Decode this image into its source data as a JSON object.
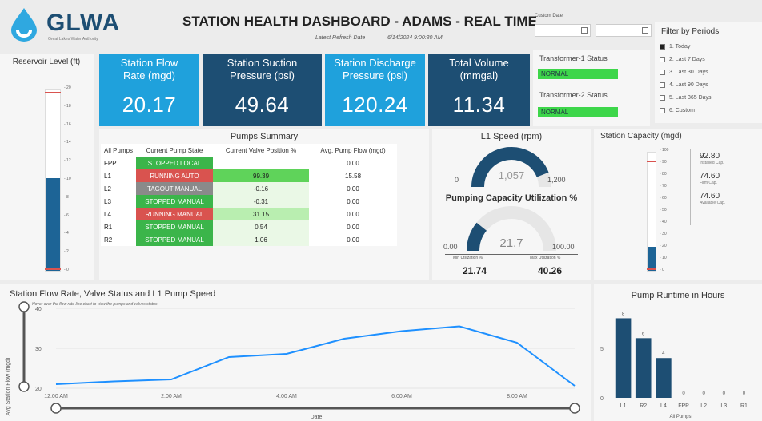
{
  "header": {
    "logo_text": "GLWA",
    "logo_sub": "Great Lakes Water Authority",
    "title": "STATION HEALTH DASHBOARD - ADAMS - REAL TIME",
    "refresh_label": "Latest Refresh Date",
    "refresh_value": "6/14/2024 9:00:30 AM",
    "custom_date_label": "Custom Date"
  },
  "filter": {
    "title": "Filter by Periods",
    "options": [
      "1. Today",
      "2. Last 7 Days",
      "3. Last 30 Days",
      "4. Last 90 Days",
      "5. Last 365 Days",
      "6. Custom"
    ],
    "selected_index": 0
  },
  "kpis": [
    {
      "title": "Station Flow Rate (mgd)",
      "value": "20.17",
      "color": "#1fa1dc"
    },
    {
      "title": "Station Suction Pressure (psi)",
      "value": "49.64",
      "color": "#1d4e73"
    },
    {
      "title": "Station Discharge Pressure (psi)",
      "value": "120.24",
      "color": "#1fa1dc"
    },
    {
      "title": "Total Volume (mmgal)",
      "value": "11.34",
      "color": "#1d4e73"
    }
  ],
  "transformers": [
    {
      "label": "Transformer-1 Status",
      "value": "NORMAL"
    },
    {
      "label": "Transformer-2 Status",
      "value": "NORMAL"
    }
  ],
  "reservoir": {
    "title": "Reservoir Level (ft)",
    "ticks": [
      "20",
      "18",
      "16",
      "14",
      "12",
      "10",
      "8",
      "6",
      "4",
      "2",
      "0"
    ],
    "level": 10.3,
    "max": 20
  },
  "pumps": {
    "title": "Pumps Summary",
    "headers": [
      "All Pumps",
      "Current Pump State",
      "Current Valve Position %",
      "Avg. Pump Flow (mgd)"
    ],
    "rows": [
      {
        "pump": "FPP",
        "state": "STOPPED LOCAL",
        "state_color": "green",
        "valve": "",
        "flow": "0.00"
      },
      {
        "pump": "L1",
        "state": "RUNNING AUTO",
        "state_color": "red",
        "valve": "99.39",
        "flow": "15.58"
      },
      {
        "pump": "L2",
        "state": "TAGOUT MANUAL",
        "state_color": "grey",
        "valve": "-0.16",
        "flow": "0.00"
      },
      {
        "pump": "L3",
        "state": "STOPPED MANUAL",
        "state_color": "green",
        "valve": "-0.31",
        "flow": "0.00"
      },
      {
        "pump": "L4",
        "state": "RUNNING MANUAL",
        "state_color": "red",
        "valve": "31.15",
        "flow": "0.00"
      },
      {
        "pump": "R1",
        "state": "STOPPED MANUAL",
        "state_color": "green",
        "valve": "0.54",
        "flow": "0.00"
      },
      {
        "pump": "R2",
        "state": "STOPPED MANUAL",
        "state_color": "green",
        "valve": "1.06",
        "flow": "0.00"
      }
    ]
  },
  "l1_speed": {
    "title": "L1 Speed (rpm)",
    "value": "1,057",
    "min": "0",
    "max": "1,200",
    "fraction": 0.881
  },
  "utilization": {
    "title": "Pumping Capacity Utilization %",
    "value": "21.7",
    "min": "0.00",
    "max": "100.00",
    "fraction": 0.217,
    "min_label": "Min Utilization %",
    "max_label": "Max Utilization %",
    "min_value": "21.74",
    "max_value": "40.26"
  },
  "capacity": {
    "title": "Station Capacity (mgd)",
    "ticks": [
      "100",
      "90",
      "80",
      "70",
      "60",
      "50",
      "40",
      "30",
      "20",
      "10",
      "0"
    ],
    "level": 20.17,
    "items": [
      {
        "value": "92.80",
        "label": "Installed Cap."
      },
      {
        "value": "74.60",
        "label": "Firm Cap."
      },
      {
        "value": "74.60",
        "label": "Available Cap."
      }
    ]
  },
  "chart_data": [
    {
      "type": "line",
      "title": "Station Flow Rate, Valve Status and L1 Pump Speed",
      "subtitle": "Hover over the flow rate line chart to view the pumps and valves status",
      "xlabel": "Date",
      "ylabel": "Avg Station Flow (mgd)",
      "x_ticks": [
        "12:00 AM",
        "2:00 AM",
        "4:00 AM",
        "6:00 AM",
        "8:00 AM"
      ],
      "y_ticks": [
        "40",
        "30",
        "20"
      ],
      "ylim": [
        20,
        40
      ],
      "x": [
        0.0,
        1.0,
        2.0,
        3.0,
        4.0,
        5.0,
        6.0,
        7.0,
        8.0,
        9.0
      ],
      "values": [
        21.0,
        21.7,
        22.2,
        27.8,
        28.6,
        32.4,
        34.3,
        35.5,
        31.4,
        20.6
      ]
    },
    {
      "type": "bar",
      "title": "Pump Runtime in Hours",
      "xlabel": "All Pumps",
      "y_ticks": [
        "5",
        "0"
      ],
      "categories": [
        "L1",
        "R2",
        "L4",
        "FPP",
        "L2",
        "L3",
        "R1"
      ],
      "values": [
        8,
        6,
        4,
        0,
        0,
        0,
        0
      ],
      "ylim": [
        0,
        9
      ]
    }
  ],
  "colors": {
    "kpi_blue": "#1fa1dc",
    "kpi_navy": "#1d4e73",
    "normal_green": "#3dd64a",
    "gauge": "#1d4e73",
    "line": "#1e90ff",
    "bar": "#1d4e73"
  }
}
